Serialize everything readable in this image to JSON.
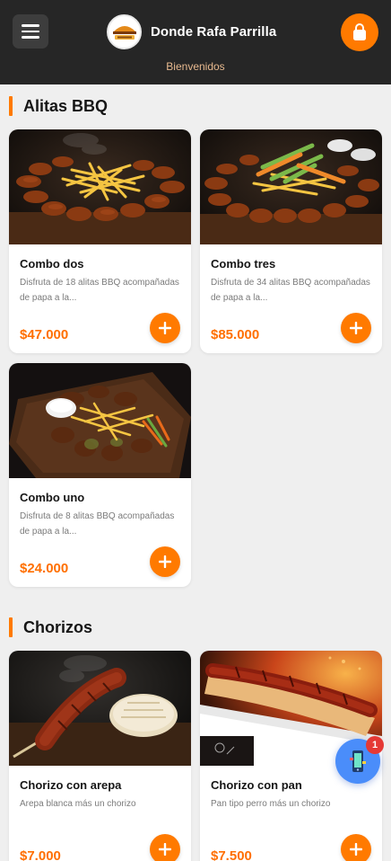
{
  "header": {
    "brand": "Donde Rafa Parrilla",
    "subtitle": "Bienvenidos"
  },
  "sections": [
    {
      "title": "Alitas BBQ",
      "items": [
        {
          "name": "Combo dos",
          "desc": "Disfruta de 18 alitas BBQ acompañadas de papa a la...",
          "price": "$47.000"
        },
        {
          "name": "Combo tres",
          "desc": "Disfruta de 34 alitas BBQ acompañadas de papa a la...",
          "price": "$85.000"
        },
        {
          "name": "Combo uno",
          "desc": "Disfruta de 8 alitas BBQ acompañadas de papa a la...",
          "price": "$24.000"
        }
      ]
    },
    {
      "title": "Chorizos",
      "items": [
        {
          "name": "Chorizo con arepa",
          "desc": "Arepa blanca más un chorizo",
          "price": "$7.000"
        },
        {
          "name": "Chorizo con pan",
          "desc": "Pan tipo perro más un chorizo",
          "price": "$7.500"
        }
      ]
    }
  ],
  "fab": {
    "badge": "1"
  },
  "colors": {
    "accent": "#ff7a00",
    "header": "#262626",
    "price": "#ff6f00",
    "fab": "#4a8dfa",
    "badge": "#e53935"
  },
  "icons": [
    "menu-icon",
    "logo",
    "shopping-bag-icon",
    "plus-icon",
    "mobile-phone-icon"
  ]
}
